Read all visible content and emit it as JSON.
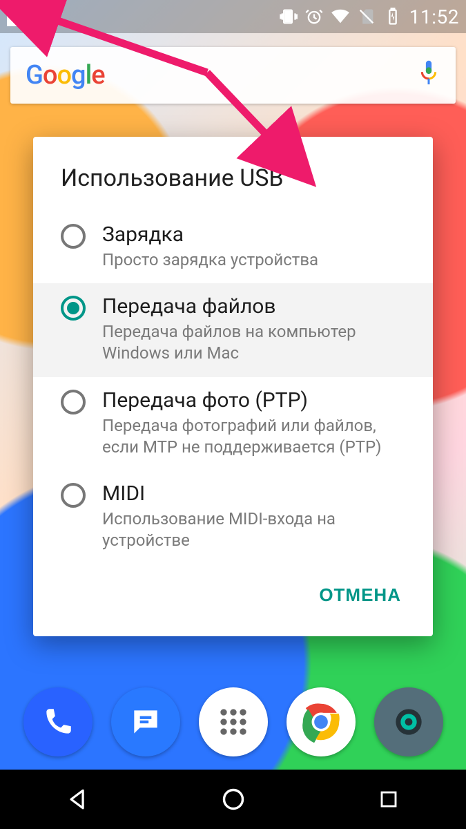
{
  "status_bar": {
    "time": "11:52",
    "icons": [
      "usb",
      "vibrate",
      "alarm",
      "wifi",
      "no-sim",
      "battery-charging"
    ]
  },
  "search": {
    "brand": "Google"
  },
  "dialog": {
    "title": "Использование USB",
    "options": [
      {
        "id": "charging",
        "selected": false,
        "title": "Зарядка",
        "desc": "Просто зарядка устройства"
      },
      {
        "id": "mtp",
        "selected": true,
        "title": "Передача файлов",
        "desc": "Передача файлов на компьютер Windows или Mac"
      },
      {
        "id": "ptp",
        "selected": false,
        "title": "Передача фото (PTP)",
        "desc": "Передача фотографий или файлов, если MTP не поддерживается (PTP)"
      },
      {
        "id": "midi",
        "selected": false,
        "title": "MIDI",
        "desc": "Использование MIDI-входа на устройстве"
      }
    ],
    "cancel": "ОТМЕНА"
  },
  "dock": {
    "apps": [
      "phone",
      "messages",
      "app-drawer",
      "chrome",
      "camera"
    ]
  },
  "annotation": {
    "color": "#ee1b6b"
  }
}
